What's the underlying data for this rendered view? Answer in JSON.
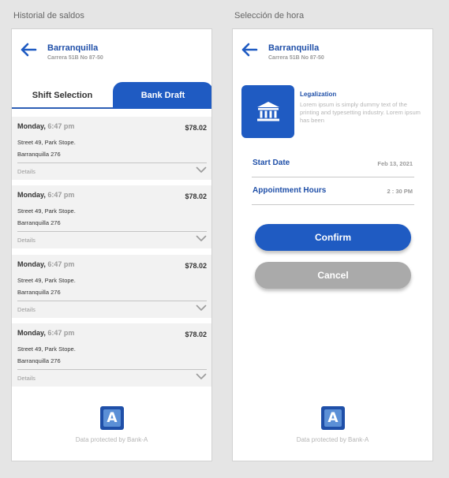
{
  "labels": {
    "artboard1": "Historial de saldos",
    "artboard2": "Selección de hora"
  },
  "header": {
    "title": "Barranquilla",
    "subtitle": "Carrera 51B No 87-50"
  },
  "tabs": {
    "left": "Shift Selection",
    "right": "Bank Draft"
  },
  "transactions": [
    {
      "day": "Monday,",
      "time": "6:47 pm",
      "amount": "$78.02",
      "line1": "Street 49, Park Stope.",
      "line2": "Barranquilla 276",
      "details": "Details"
    },
    {
      "day": "Monday,",
      "time": "6:47 pm",
      "amount": "$78.02",
      "line1": "Street 49, Park Stope.",
      "line2": "Barranquilla 276",
      "details": "Details"
    },
    {
      "day": "Monday,",
      "time": "6:47 pm",
      "amount": "$78.02",
      "line1": "Street 49, Park Stope.",
      "line2": "Barranquilla 276",
      "details": "Details"
    },
    {
      "day": "Monday,",
      "time": "6:47 pm",
      "amount": "$78.02",
      "line1": "Street 49, Park Stope.",
      "line2": "Barranquilla 276",
      "details": "Details"
    }
  ],
  "service": {
    "title": "Legalization",
    "description": "Lorem ipsum is simply dummy text of the printing and typesetting industry. Lorem ipsum has been"
  },
  "fields": {
    "start_label": "Start Date",
    "start_value": "Feb 13, 2021",
    "hours_label": "Appointment Hours",
    "hours_value": "2 : 30 PM"
  },
  "buttons": {
    "confirm": "Confirm",
    "cancel": "Cancel"
  },
  "footer": {
    "logo_letter": "A",
    "text": "Data protected by Bank-A"
  },
  "colors": {
    "primary": "#1f5bc2",
    "title_blue": "#1f4fa8",
    "cancel_gray": "#aaaaaa"
  },
  "icons": {
    "back": "arrow-left-icon",
    "chevron": "chevron-down-icon",
    "service": "bank-building-icon"
  }
}
